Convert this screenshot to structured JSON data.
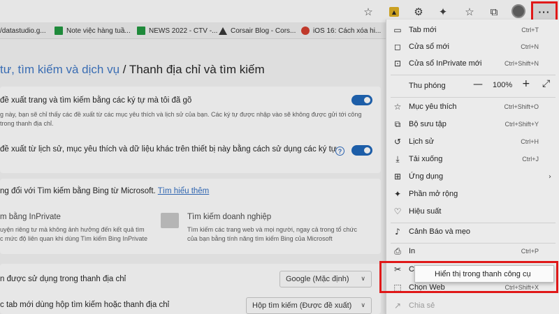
{
  "favorites": [
    {
      "label": "/datastudio.g...",
      "icon": "none"
    },
    {
      "label": "Note việc hàng tuầ...",
      "icon": "sheet-icon"
    },
    {
      "label": "NEWS 2022 - CTV -...",
      "icon": "sheet-icon"
    },
    {
      "label": "Corsair Blog - Cors...",
      "icon": "corsair-icon"
    },
    {
      "label": "iOS 16: Cách xóa hi...",
      "icon": "site-icon"
    }
  ],
  "page": {
    "title_link": "tư, tìm kiếm và dịch vụ",
    "title_sep": " / ",
    "title_current": "Thanh địa chỉ và tìm kiếm",
    "row1_title": "đề xuất trang và tìm kiếm bằng các ký tự mà tôi đã gõ",
    "row1_desc1": "g này, bạn sẽ chỉ thấy các đề xuất từ các mục yêu thích và lịch sử của bạn. Các ký tự được nhập vào sẽ không được gửi tới công",
    "row1_desc2": "trong thanh địa chỉ.",
    "row2_title": "đề xuất từ lịch sử, mục yêu thích và dữ liệu khác trên thiết bị này bằng cách sử dụng các ký tự",
    "help": "?",
    "bing_text": "ng đổi với Tìm kiếm bằng Bing từ Microsoft.",
    "bing_link": "Tìm hiểu thêm",
    "inprivate_title": "m bằng InPrivate",
    "inprivate_desc1": "uyện riêng tư mà không ảnh hưởng đến kết quả tìm",
    "inprivate_desc2": "c mức độ liên quan khi dùng Tìm kiếm Bing InPrivate",
    "ent_title": "Tìm kiếm doanh nghiệp",
    "ent_desc1": "Tìm kiếm các trang web và mọi người, ngay cả trong tổ chức",
    "ent_desc2": "của bạn bằng tính năng tìm kiếm Bing của Microsoft",
    "engine_label": "n được sử dụng trong thanh địa chỉ",
    "engine_value": "Google (Mặc định)",
    "newtab_label": "c tab mới dùng hộp tìm kiếm hoặc thanh địa chỉ",
    "newtab_value": "Hộp tìm kiếm (Được đề xuất)"
  },
  "toolbar": {
    "more": "···"
  },
  "menu": {
    "new_tab": {
      "label": "Tab mới",
      "shortcut": "Ctrl+T"
    },
    "new_window": {
      "label": "Cửa sổ mới",
      "shortcut": "Ctrl+N"
    },
    "inprivate": {
      "label": "Cửa sổ InPrivate mới",
      "shortcut": "Ctrl+Shift+N"
    },
    "zoom": {
      "label": "Thu phóng",
      "minus": "—",
      "value": "100%",
      "plus": "+"
    },
    "favorites": {
      "label": "Mục yêu thích",
      "shortcut": "Ctrl+Shift+O"
    },
    "collections": {
      "label": "Bộ sưu tập",
      "shortcut": "Ctrl+Shift+Y"
    },
    "history": {
      "label": "Lịch sử",
      "shortcut": "Ctrl+H"
    },
    "downloads": {
      "label": "Tải xuống",
      "shortcut": "Ctrl+J"
    },
    "apps": {
      "label": "Ứng dụng"
    },
    "extensions": {
      "label": "Phần mở rộng"
    },
    "performance": {
      "label": "Hiệu suất"
    },
    "alerts": {
      "label": "Cảnh Báo và mẹo"
    },
    "print": {
      "label": "In",
      "shortcut": "Ctrl+P"
    },
    "capture": {
      "label": "Ch"
    },
    "web_select": {
      "label": "Chọn Web",
      "shortcut": "Ctrl+Shift+X"
    },
    "share": {
      "label": "Chia sẻ"
    }
  },
  "popup": {
    "label": "Hiển thị trong thanh công cụ"
  }
}
